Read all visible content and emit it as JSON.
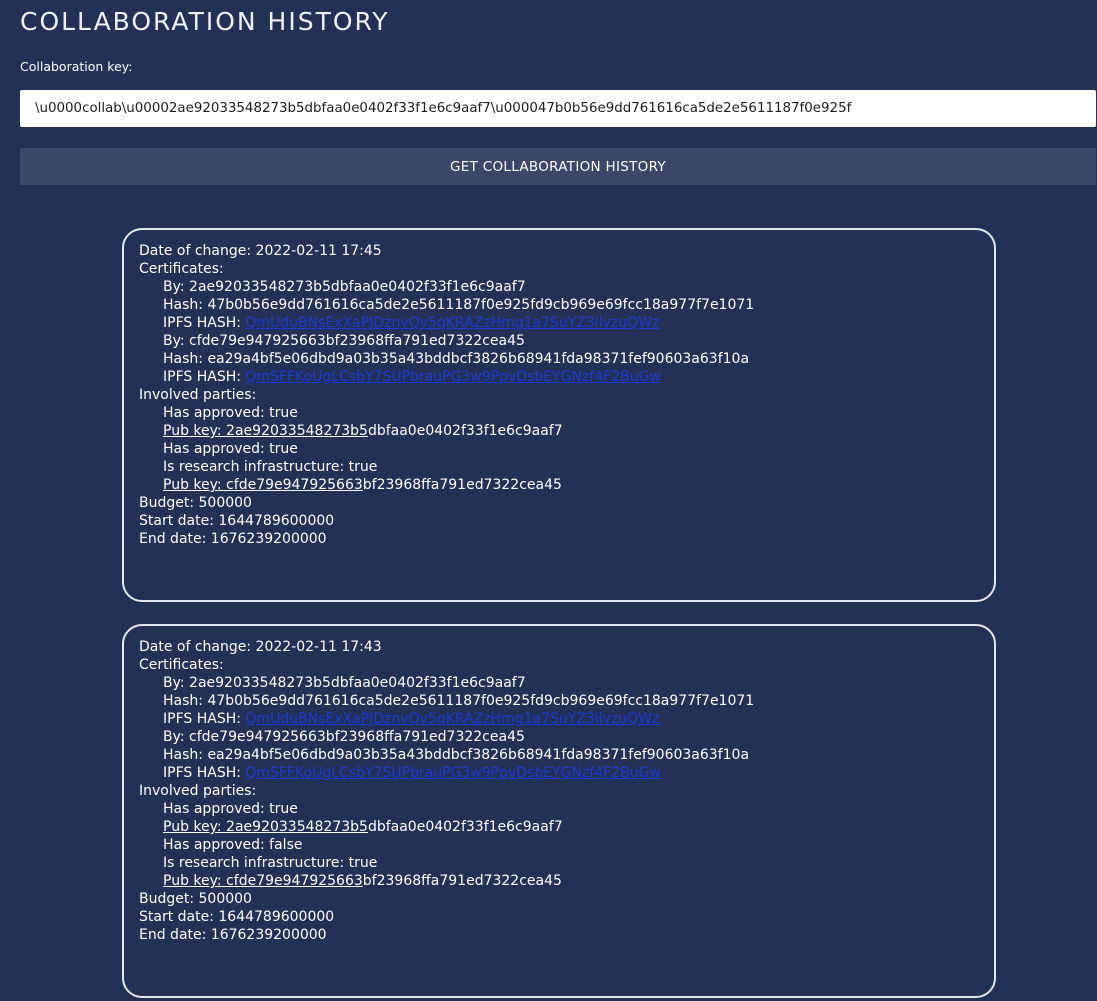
{
  "header": {
    "title": "COLLABORATION HISTORY",
    "key_label": "Collaboration key:",
    "key_value": "\\u0000collab\\u00002ae92033548273b5dbfaa0e0402f33f1e6c9aaf7\\u000047b0b56e9dd761616ca5de2e5611187f0e925f",
    "button_label": "GET COLLABORATION HISTORY"
  },
  "colors": {
    "background": "#243156",
    "button_background": "#3b4668",
    "card_border": "#e4e8f0",
    "link": "#1f3bd6"
  },
  "history": [
    {
      "date_of_change": "Date of change: 2022-02-11 17:45",
      "certificates_label": "Certificates:",
      "certificates": [
        {
          "by": "By: 2ae92033548273b5dbfaa0e0402f33f1e6c9aaf7",
          "hash": "Hash: 47b0b56e9dd761616ca5de2e5611187f0e925fd9cb969e69fcc18a977f7e1071",
          "ipfs_label": "IPFS HASH:",
          "ipfs_hash": "QmUduBNsExXaPJDznvQv5qKRAZzHmg1a7SuYZ3ilvzuQWz"
        },
        {
          "by": "By: cfde79e947925663bf23968ffa791ed7322cea45",
          "hash": "Hash: ea29a4bf5e06dbd9a03b35a43bddbcf3826b68941fda98371fef90603a63f10a",
          "ipfs_label": "IPFS HASH:",
          "ipfs_hash": "QmSFFKoUgLCsbY7SUPbrauPG3w9PpvDsbEYGNzf4F2BuGw"
        }
      ],
      "parties_label": "Involved parties:",
      "parties": [
        {
          "lines": [
            "Has approved: true"
          ],
          "pub_key_label": "Pub key: 2ae92033548273b5",
          "pub_key_rest": "dbfaa0e0402f33f1e6c9aaf7"
        },
        {
          "lines": [
            "Has approved: true",
            "Is research infrastructure: true"
          ],
          "pub_key_label": "Pub key: cfde79e947925663",
          "pub_key_rest": "bf23968ffa791ed7322cea45"
        }
      ],
      "budget": "Budget: 500000",
      "start_date": "Start date: 1644789600000",
      "end_date": "End date: 1676239200000"
    },
    {
      "date_of_change": "Date of change: 2022-02-11 17:43",
      "certificates_label": "Certificates:",
      "certificates": [
        {
          "by": "By: 2ae92033548273b5dbfaa0e0402f33f1e6c9aaf7",
          "hash": "Hash: 47b0b56e9dd761616ca5de2e5611187f0e925fd9cb969e69fcc18a977f7e1071",
          "ipfs_label": "IPFS HASH:",
          "ipfs_hash": "QmUduBNsExXaPJDznvQv5qKRAZzHmg1a7SuYZ3ilvzuQWz"
        },
        {
          "by": "By: cfde79e947925663bf23968ffa791ed7322cea45",
          "hash": "Hash: ea29a4bf5e06dbd9a03b35a43bddbcf3826b68941fda98371fef90603a63f10a",
          "ipfs_label": "IPFS HASH:",
          "ipfs_hash": "QmSFFKoUgLCsbY7SUPbrauPG3w9PpvDsbEYGNzf4F2BuGw"
        }
      ],
      "parties_label": "Involved parties:",
      "parties": [
        {
          "lines": [
            "Has approved: true"
          ],
          "pub_key_label": "Pub key: 2ae92033548273b5",
          "pub_key_rest": "dbfaa0e0402f33f1e6c9aaf7"
        },
        {
          "lines": [
            "Has approved: false",
            "Is research infrastructure: true"
          ],
          "pub_key_label": "Pub key: cfde79e947925663",
          "pub_key_rest": "bf23968ffa791ed7322cea45"
        }
      ],
      "budget": "Budget: 500000",
      "start_date": "Start date: 1644789600000",
      "end_date": "End date: 1676239200000"
    }
  ]
}
